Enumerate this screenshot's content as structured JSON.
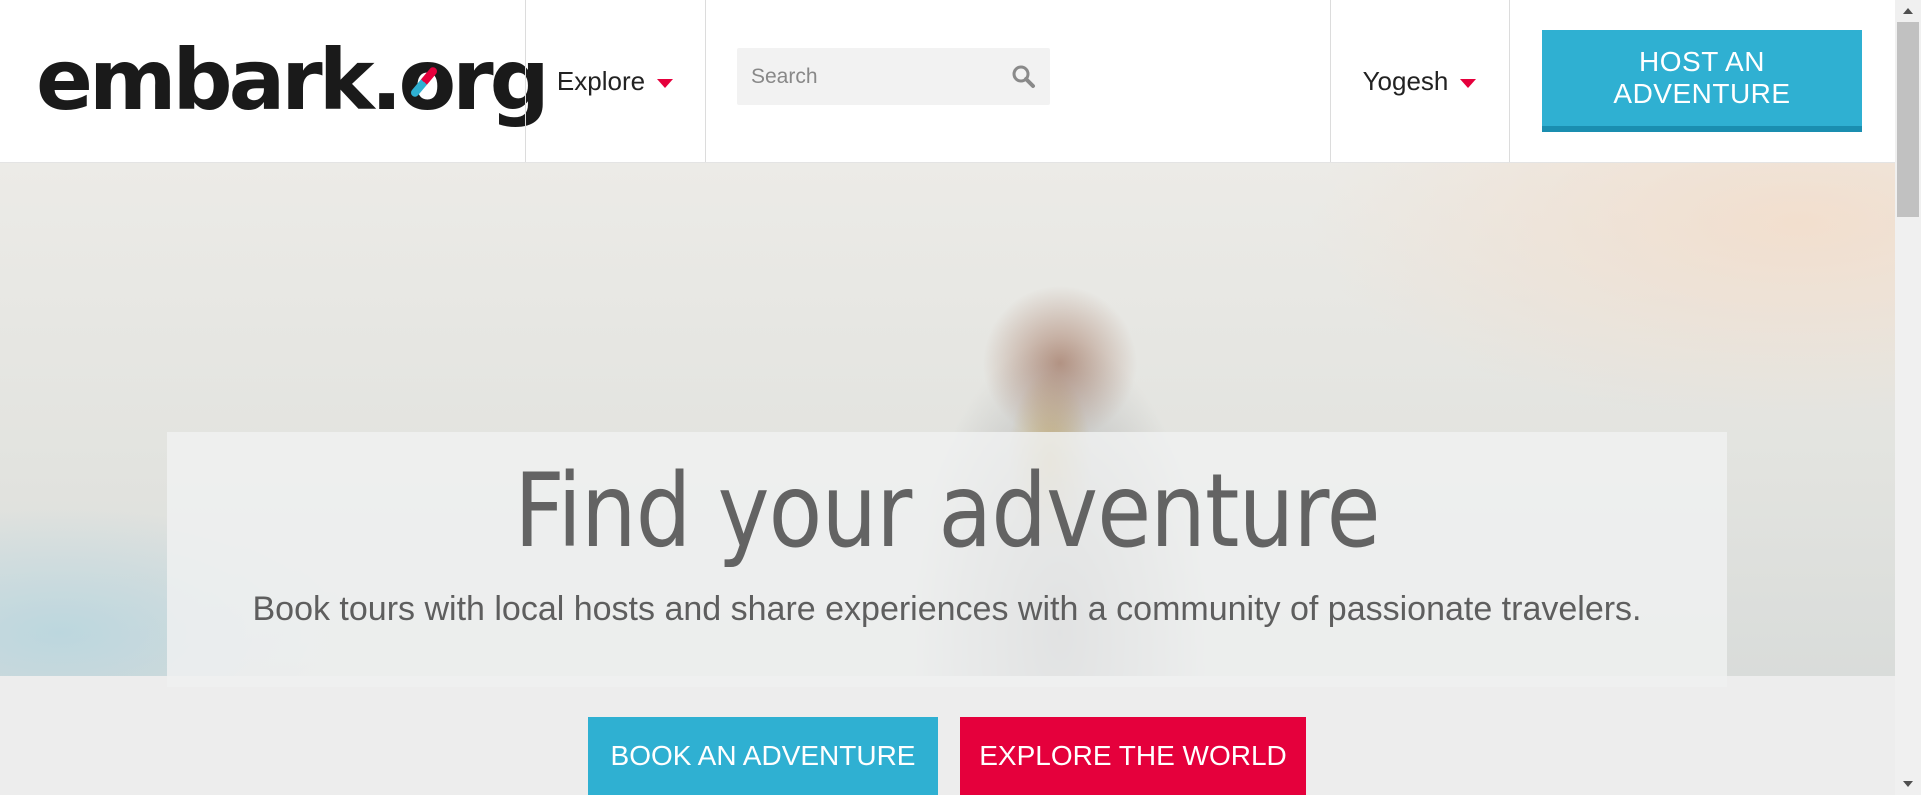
{
  "header": {
    "logo": {
      "pre": "embark.",
      "o": "o",
      "post": "rg"
    },
    "nav": {
      "explore_label": "Explore",
      "user_label": "Yogesh"
    },
    "search": {
      "placeholder": "Search",
      "value": ""
    },
    "host_button": "HOST AN ADVENTURE"
  },
  "hero": {
    "title": "Find your adventure",
    "subtitle": "Book tours with local hosts and share experiences with a community of passionate travelers."
  },
  "cta": {
    "book": "BOOK AN ADVENTURE",
    "explore": "EXPLORE THE WORLD"
  },
  "icons": {
    "logo_compass": "compass-needle-icon",
    "dropdown": "caret-down-icon",
    "search": "search-icon",
    "scroll_up": "scroll-up-arrow-icon",
    "scroll_down": "scroll-down-arrow-icon"
  },
  "colors": {
    "accent_blue": "#2fb0d2",
    "accent_red": "#e5003c",
    "text_dark": "#222222",
    "hero_text": "#636363"
  }
}
